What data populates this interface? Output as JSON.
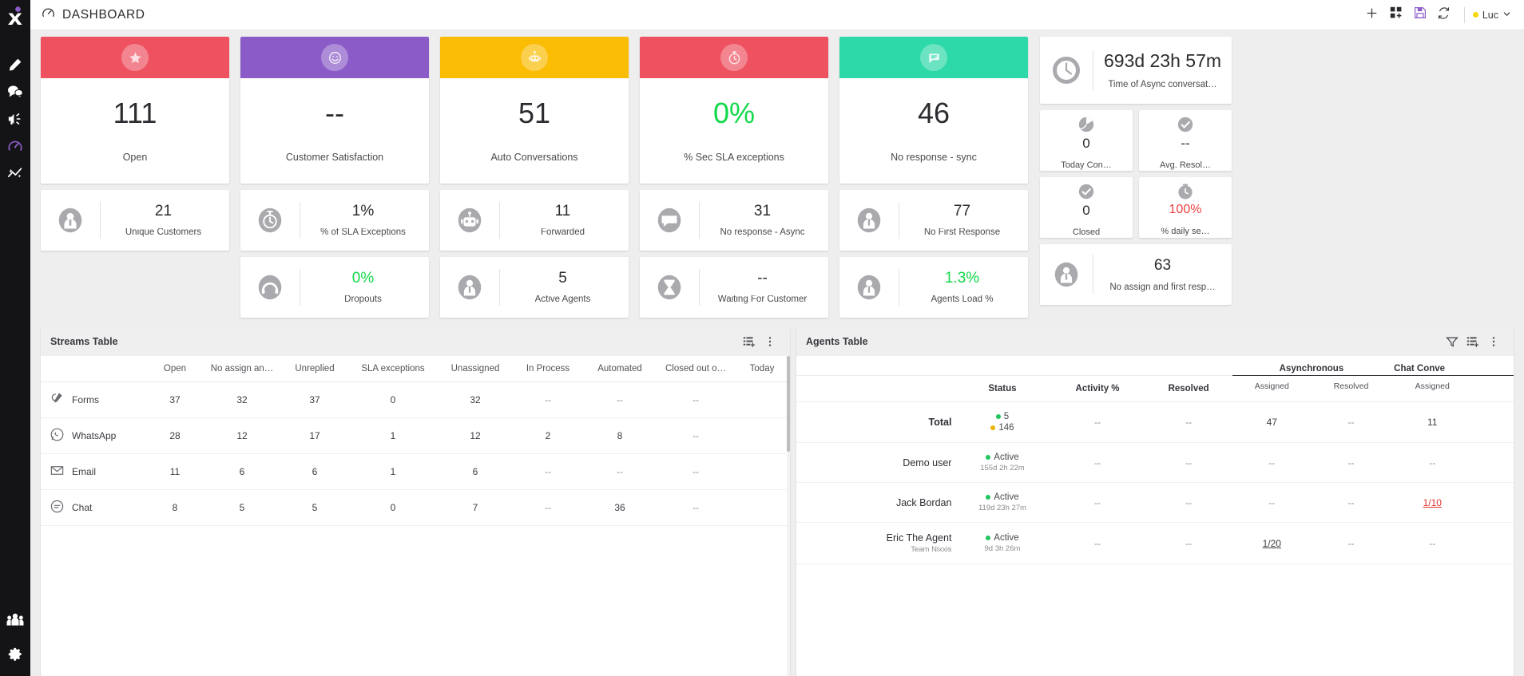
{
  "app": {
    "page_title": "DASHBOARD",
    "logo_icon": "nixxis-x-logo",
    "title_icon": "dashboard-gauge-icon"
  },
  "rail": {
    "items": [
      {
        "name": "edit-pencil-icon",
        "active": false
      },
      {
        "name": "chat-bubbles-icon",
        "active": false
      },
      {
        "name": "megaphone-campaign-icon",
        "active": false
      },
      {
        "name": "dashboard-gauge-icon",
        "active": true
      },
      {
        "name": "analytics-sparkline-icon",
        "active": false
      }
    ],
    "bottom": [
      {
        "name": "team-people-icon"
      },
      {
        "name": "settings-gear-icon"
      }
    ]
  },
  "header": {
    "actions": [
      {
        "name": "add-widget-icon",
        "label": "+"
      },
      {
        "name": "add-dashboard-grid-icon",
        "label": ""
      },
      {
        "name": "save-floppy-icon",
        "label": ""
      },
      {
        "name": "refresh-icon",
        "label": ""
      }
    ],
    "user": {
      "name": "Luc",
      "status_color": "#f5d90a"
    }
  },
  "kpi_cards": [
    {
      "icon": "star-icon",
      "color": "#ee5160",
      "value": "111",
      "label": "Open",
      "value_color": "default"
    },
    {
      "icon": "smiley-face-icon",
      "color": "#8b5cc7",
      "value": "--",
      "label": "Customer Satisfaction",
      "value_color": "default"
    },
    {
      "icon": "robot-icon",
      "color": "#fbbc04",
      "value": "51",
      "label": "Auto Conversations",
      "value_color": "default"
    },
    {
      "icon": "stopwatch-icon",
      "color": "#ee5160",
      "value": "0%",
      "label": "% Sec SLA exceptions",
      "value_color": "green"
    },
    {
      "icon": "speech-bubble-icon",
      "color": "#2dd9a8",
      "value": "46",
      "label": "No response - sync",
      "value_color": "default"
    }
  ],
  "mini_row_1": [
    {
      "icon": "customer-person-icon",
      "value": "21",
      "label": "Unique Customers",
      "value_color": "default"
    },
    {
      "icon": "stopwatch-icon",
      "value": "1%",
      "label": "% of SLA Exceptions",
      "value_color": "default"
    },
    {
      "icon": "robot-icon",
      "value": "11",
      "label": "Forwarded",
      "value_color": "default"
    },
    {
      "icon": "speech-bubble-icon",
      "value": "31",
      "label": "No response - Async",
      "value_color": "default"
    },
    {
      "icon": "agent-person-icon",
      "value": "77",
      "label": "No First Response",
      "value_color": "default"
    }
  ],
  "mini_row_2": [
    {
      "icon": "",
      "value": "",
      "label": "",
      "empty": true
    },
    {
      "icon": "headset-dropout-icon",
      "value": "0%",
      "label": "Dropouts",
      "value_color": "green"
    },
    {
      "icon": "agent-person-icon",
      "value": "5",
      "label": "Active Agents",
      "value_color": "default"
    },
    {
      "icon": "hourglass-icon",
      "value": "--",
      "label": "Waiting For Customer",
      "value_color": "default"
    },
    {
      "icon": "agent-person-icon",
      "value": "1.3%",
      "label": "Agents Load %",
      "value_color": "green"
    }
  ],
  "side_column": {
    "wide_card": {
      "icon": "clock-icon",
      "value": "693d 23h 57m",
      "label": "Time of Async conversat…"
    },
    "small_cards_row1": [
      {
        "icon": "pie-chart-icon",
        "value": "0",
        "label": "Today Con…",
        "value_color": "default"
      },
      {
        "icon": "check-circle-icon",
        "value": "--",
        "label": "Avg. Resol…",
        "value_color": "default"
      }
    ],
    "small_cards_row2": [
      {
        "icon": "check-circle-icon",
        "value": "0",
        "label": "Closed",
        "value_color": "default"
      },
      {
        "icon": "stopwatch-icon",
        "value": "100%",
        "label": "% daily se…",
        "value_color": "red"
      }
    ],
    "wide_card_bottom": {
      "icon": "agent-person-icon",
      "value": "63",
      "label": "No assign and first resp…"
    }
  },
  "streams_table": {
    "title": "Streams Table",
    "header_icons": [
      "add-column-icon",
      "more-vertical-icon"
    ],
    "columns": [
      "",
      "Open",
      "No assign an…",
      "Unreplied",
      "SLA exceptions",
      "Unassigned",
      "In Process",
      "Automated",
      "Closed out o…",
      "Today"
    ],
    "rows": [
      {
        "icon": "forms-icon",
        "name": "Forms",
        "cells": [
          "37",
          "32",
          "37",
          "0",
          "32",
          "--",
          "--",
          "--",
          ""
        ]
      },
      {
        "icon": "whatsapp-icon",
        "name": "WhatsApp",
        "cells": [
          "28",
          "12",
          "17",
          "1",
          "12",
          "2",
          "8",
          "--",
          ""
        ]
      },
      {
        "icon": "email-icon",
        "name": "Email",
        "cells": [
          "11",
          "6",
          "6",
          "1",
          "6",
          "--",
          "--",
          "--",
          ""
        ]
      },
      {
        "icon": "chat-icon",
        "name": "Chat",
        "cells": [
          "8",
          "5",
          "5",
          "0",
          "7",
          "--",
          "36",
          "--",
          ""
        ]
      }
    ]
  },
  "agents_table": {
    "title": "Agents Table",
    "header_icons": [
      "filter-icon",
      "add-column-icon",
      "more-vertical-icon"
    ],
    "group_headers": [
      {
        "label": "Asynchronous",
        "span": 2
      },
      {
        "label": "Chat Conve",
        "span": 2
      }
    ],
    "columns": [
      "",
      "Status",
      "Activity %",
      "Resolved",
      "Assigned",
      "Resolved",
      "Assigned",
      ""
    ],
    "rows": [
      {
        "name": "Total",
        "sub": "",
        "is_total": true,
        "status_lines": [
          {
            "dot": "green",
            "text": "5"
          },
          {
            "dot": "yellow",
            "text": "146"
          }
        ],
        "cells": [
          "--",
          "--",
          "47",
          "--",
          "11",
          ""
        ]
      },
      {
        "name": "Demo user",
        "sub": "",
        "is_total": false,
        "status_lines": [
          {
            "dot": "green",
            "text": "Active"
          }
        ],
        "status_sub": "155d 2h 22m",
        "cells": [
          "--",
          "--",
          "--",
          "--",
          "--",
          ""
        ]
      },
      {
        "name": "Jack Bordan",
        "sub": "",
        "is_total": false,
        "status_lines": [
          {
            "dot": "green",
            "text": "Active"
          }
        ],
        "status_sub": "119d 23h 27m",
        "cells": [
          "--",
          "--",
          "--",
          "--",
          "1/10",
          ""
        ],
        "highlight_index": 4
      },
      {
        "name": "Eric The Agent",
        "sub": "Team Nixxis",
        "is_total": false,
        "status_lines": [
          {
            "dot": "green",
            "text": "Active"
          }
        ],
        "status_sub": "9d 3h 26m",
        "cells": [
          "--",
          "--",
          "1/20",
          "--",
          "--",
          ""
        ],
        "underline_index": 2
      }
    ]
  }
}
